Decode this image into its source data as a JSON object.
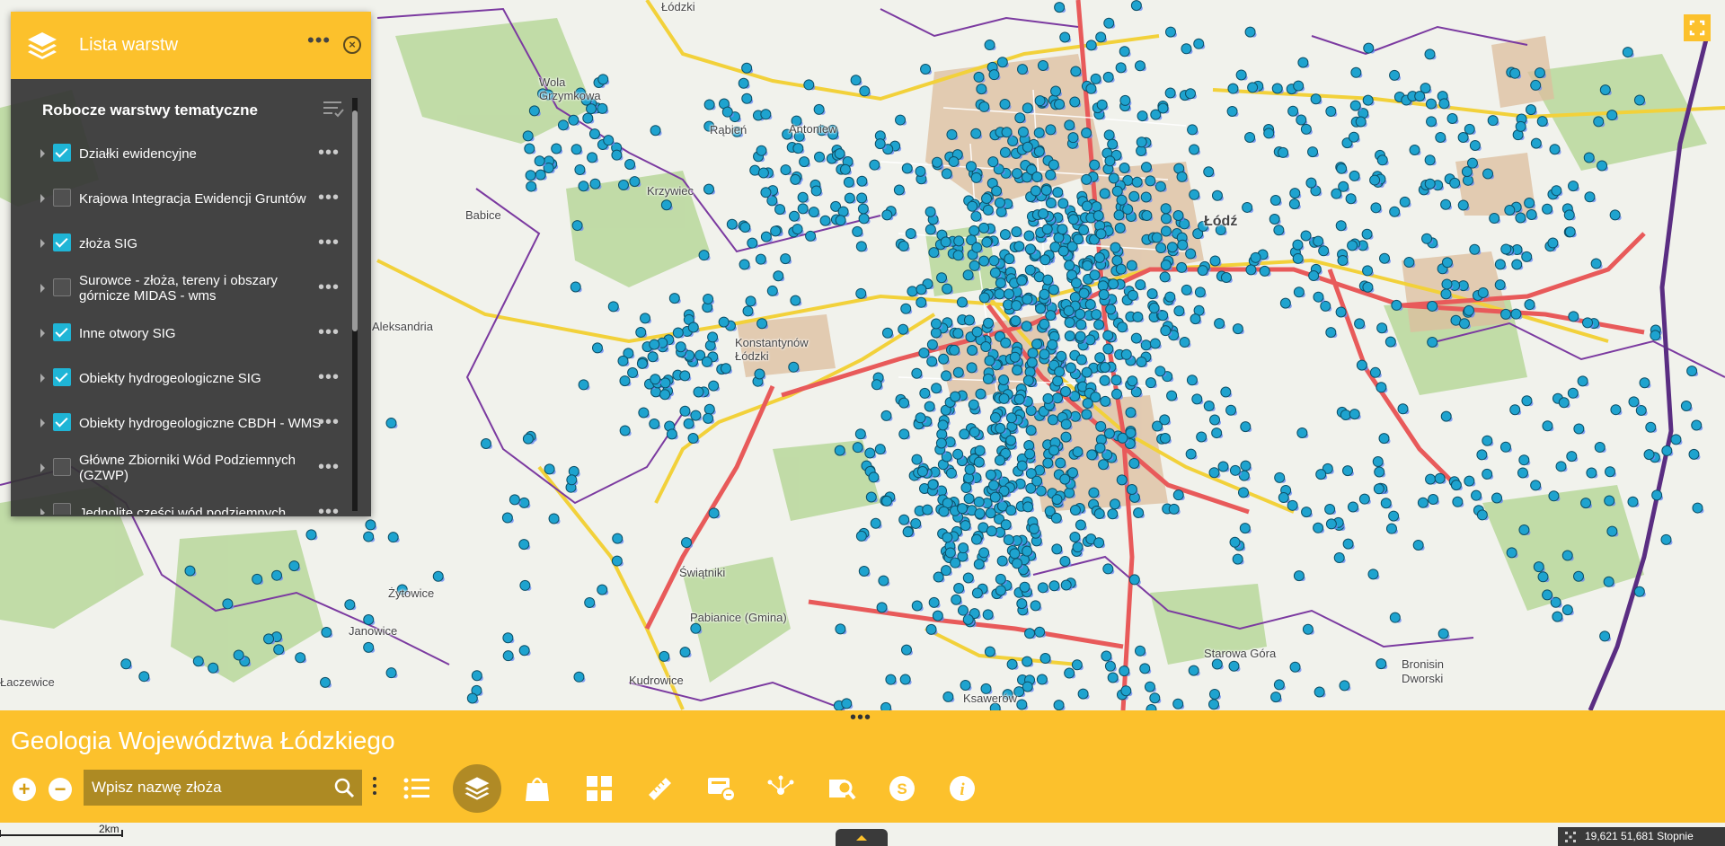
{
  "layer_panel": {
    "title": "Lista warstw",
    "subtitle": "Robocze warstwy tematyczne",
    "layers": [
      {
        "label": "Działki ewidencyjne",
        "checked": true
      },
      {
        "label": "Krajowa Integracja Ewidencji Gruntów",
        "checked": false
      },
      {
        "label": "złoża SIG",
        "checked": true
      },
      {
        "label": "Surowce - złoża, tereny i obszary górnicze MIDAS - wms",
        "checked": false
      },
      {
        "label": "Inne otwory SIG",
        "checked": true
      },
      {
        "label": "Obiekty hydrogeologiczne SIG",
        "checked": true
      },
      {
        "label": "Obiekty hydrogeologiczne CBDH - WMS",
        "checked": true
      },
      {
        "label": "Główne Zbiorniki Wód Podziemnych (GZWP)",
        "checked": false
      },
      {
        "label": "Jednolite części wód podziemnych",
        "checked": false
      }
    ]
  },
  "bottom_bar": {
    "app_title": "Geologia Województwa Łódzkiego",
    "zoom_in": "+",
    "zoom_out": "−",
    "search_placeholder": "Wpisz nazwę złoża",
    "tools": [
      {
        "icon": "legend-list-icon"
      },
      {
        "icon": "layers-icon",
        "active": true
      },
      {
        "icon": "basemap-bag-icon"
      },
      {
        "icon": "grid-icon"
      },
      {
        "icon": "ruler-icon"
      },
      {
        "icon": "print-icon"
      },
      {
        "icon": "share-icon"
      },
      {
        "icon": "zoom-search-icon"
      },
      {
        "icon": "dollar-icon"
      },
      {
        "icon": "info-icon"
      }
    ]
  },
  "map": {
    "scale_label": "2km",
    "coordinates": "19,621 51,681 Stopnie",
    "place_labels": [
      "Łódzki",
      "Wola Grzymkowa",
      "Rąbień",
      "Antoniew",
      "Krzywiec",
      "Babice",
      "Łódź",
      "Konstantynów Łódzki",
      "Aleksandria",
      "Świątniki",
      "Pabianice (Gmina)",
      "Żytowice",
      "Janowice",
      "Kudrowice",
      "Ksawerów",
      "Starowa Góra",
      "Bronisin Dworski",
      "Łaczewice"
    ],
    "colors": {
      "accent": "#fcc12c",
      "point": "#1ea3cf",
      "road_red": "#e85a5a",
      "boundary_purple": "#7b3aa0",
      "forest": "#b9d89b",
      "urban": "#d9b89b"
    }
  }
}
